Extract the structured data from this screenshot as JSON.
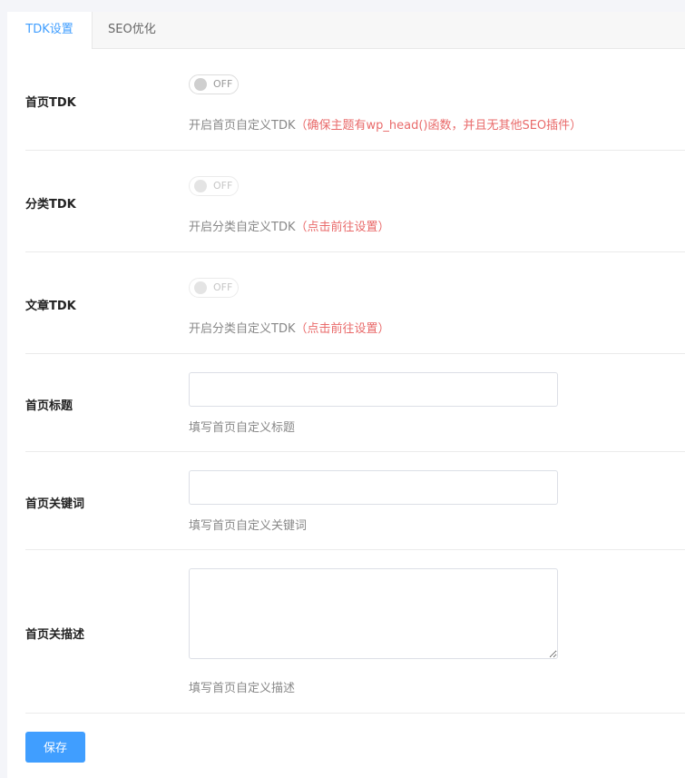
{
  "tabs": [
    {
      "label": "TDK设置",
      "active": true
    },
    {
      "label": "SEO优化",
      "active": false
    }
  ],
  "home_tdk": {
    "label": "首页TDK",
    "toggle": "OFF",
    "desc": "开启首页自定义TDK",
    "note": "（确保主题有wp_head()函数，并且无其他SEO插件）"
  },
  "category_tdk": {
    "label": "分类TDK",
    "toggle": "OFF",
    "desc": "开启分类自定义TDK",
    "note": "（点击前往设置）"
  },
  "article_tdk": {
    "label": "文章TDK",
    "toggle": "OFF",
    "desc": "开启分类自定义TDK",
    "note": "（点击前往设置）"
  },
  "home_title": {
    "label": "首页标题",
    "value": "",
    "help": "填写首页自定义标题"
  },
  "home_keywords": {
    "label": "首页关键词",
    "value": "",
    "help": "填写首页自定义关键词"
  },
  "home_description": {
    "label": "首页关描述",
    "value": "",
    "help": "填写首页自定义描述"
  },
  "save_button": "保存",
  "colors": {
    "accent": "#409eff",
    "warning_text": "#e96a6a"
  }
}
